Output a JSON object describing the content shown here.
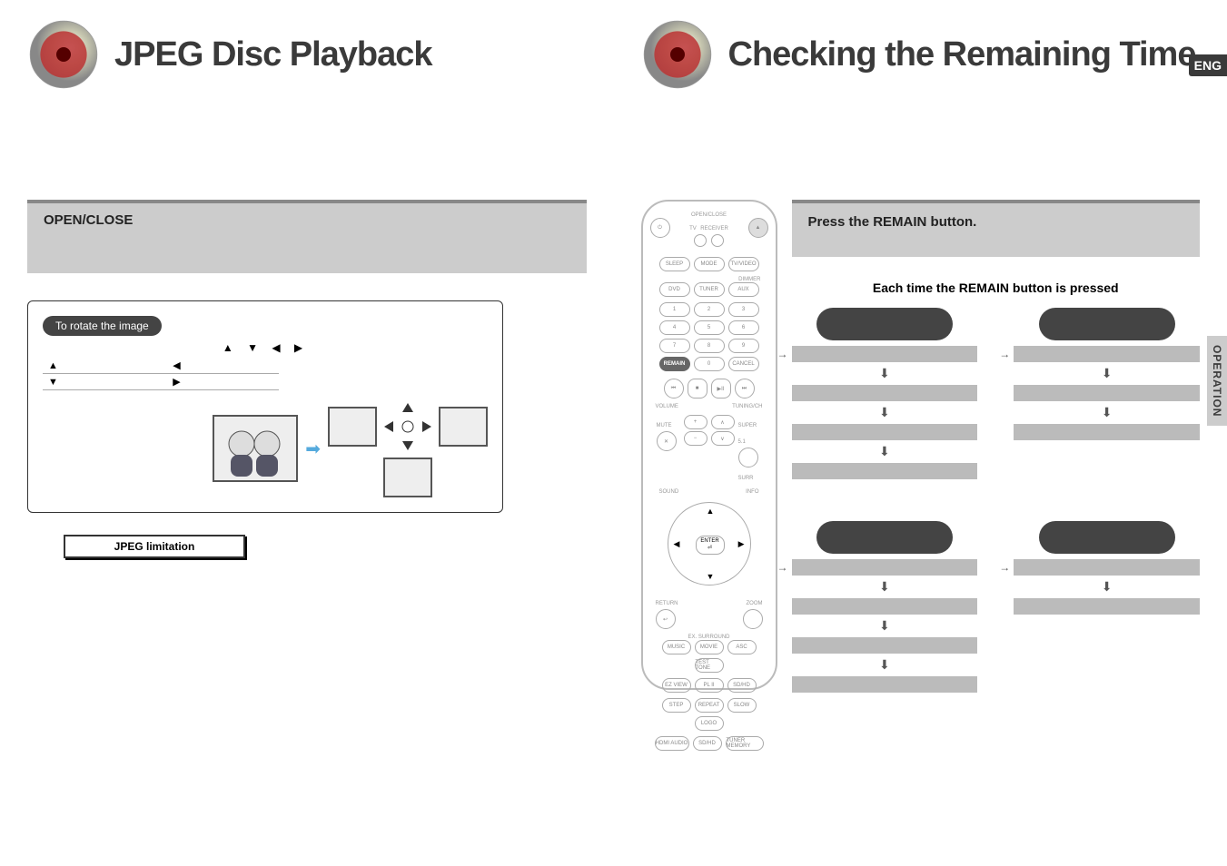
{
  "left": {
    "title": "JPEG Disc Playback",
    "banner_label": "OPEN/CLOSE",
    "rotate_tab": "To rotate the image",
    "arrow_glyph_row": "▲ ▼ ◀ ▶",
    "rotate_rows": [
      [
        "▲",
        "◀"
      ],
      [
        "▼",
        "▶"
      ]
    ],
    "jpeg_limitation_label": "JPEG limitation"
  },
  "right": {
    "title": "Checking the Remaining Time",
    "eng_badge": "ENG",
    "operation_tab": "OPERATION",
    "banner_label": "Press the REMAIN button.",
    "subheading": "Each time the REMAIN button is pressed",
    "remote": {
      "top_label": "OPEN/CLOSE",
      "tv_label": "TV",
      "receiver_label": "RECEIVER",
      "row_labels_1": [
        "SLEEP",
        "MODE",
        "TV/VIDEO"
      ],
      "dimmer_label": "DIMMER",
      "row_labels_2": [
        "DVD",
        "TUNER",
        "AUX"
      ],
      "numpad": [
        "1",
        "2",
        "3",
        "4",
        "5",
        "6",
        "7",
        "8",
        "9"
      ],
      "numpad_bottom": [
        "REMAIN",
        "0",
        "CANCEL"
      ],
      "remain_button": "REMAIN",
      "transport_prev": "⏮",
      "transport_stop": "■",
      "transport_play": "▶II",
      "transport_next": "⏭",
      "volume_label": "VOLUME",
      "tuning_label": "TUNING/CH",
      "mute_label": "MUTE",
      "super_label": "SUPER 5.1",
      "surr_label": "SURR",
      "sound_label": "SOUND",
      "info_label": "INFO",
      "enter_label": "ENTER",
      "return_label": "RETURN",
      "zoom_label": "ZOOM",
      "ex_surround_label": "EX. SURROUND",
      "row_a": [
        "MUSIC",
        "MOVIE",
        "ASC",
        "TEST TONE"
      ],
      "row_b": [
        "EZ VIEW",
        "PL II",
        "SD/HD"
      ],
      "row_c": [
        "STEP",
        "REPEAT",
        "SLOW",
        "LOGO"
      ],
      "bottom_row": [
        "HDMI AUDIO",
        "SD/HD",
        "TUNER MEMORY"
      ]
    }
  }
}
